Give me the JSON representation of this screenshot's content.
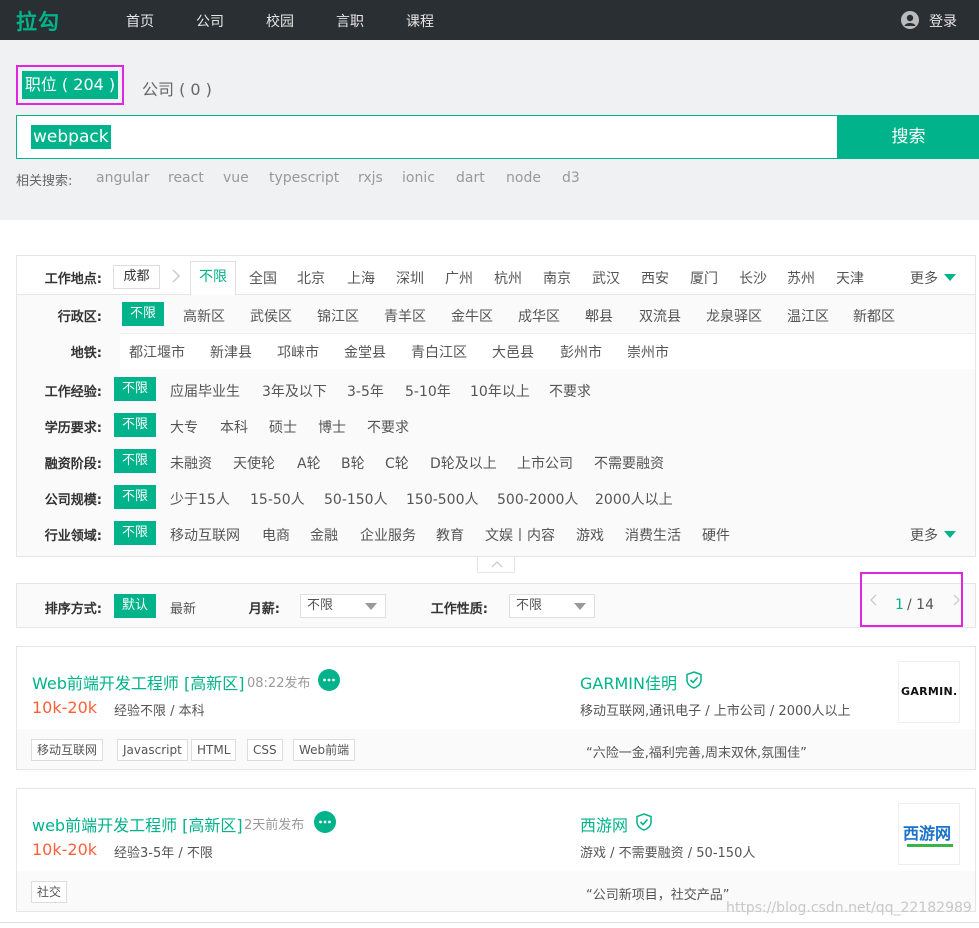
{
  "topbar": {
    "logo": "拉勾",
    "nav": [
      "首页",
      "公司",
      "校园",
      "言职",
      "课程"
    ],
    "login": "登录"
  },
  "search": {
    "tab_jobs": "职位 ( 204 )",
    "tab_companies": "公司 ( 0 )",
    "query": "webpack",
    "button": "搜索",
    "related_label": "相关搜索:",
    "related": [
      "angular",
      "react",
      "vue",
      "typescript",
      "rxjs",
      "ionic",
      "dart",
      "node",
      "d3"
    ]
  },
  "filters": {
    "location_label": "工作地点:",
    "current_city": "成都",
    "cities": [
      "不限",
      "全国",
      "北京",
      "上海",
      "深圳",
      "广州",
      "杭州",
      "南京",
      "武汉",
      "西安",
      "厦门",
      "长沙",
      "苏州",
      "天津"
    ],
    "more": "更多",
    "district_label": "行政区:",
    "districts": [
      "不限",
      "高新区",
      "武侯区",
      "锦江区",
      "青羊区",
      "金牛区",
      "成华区",
      "郫县",
      "双流县",
      "龙泉驿区",
      "温江区",
      "新都区"
    ],
    "metro_label": "地铁:",
    "metro": [
      "都江堰市",
      "新津县",
      "邛崃市",
      "金堂县",
      "青白江区",
      "大邑县",
      "彭州市",
      "崇州市"
    ],
    "experience_label": "工作经验:",
    "experience": [
      "不限",
      "应届毕业生",
      "3年及以下",
      "3-5年",
      "5-10年",
      "10年以上",
      "不要求"
    ],
    "education_label": "学历要求:",
    "education": [
      "不限",
      "大专",
      "本科",
      "硕士",
      "博士",
      "不要求"
    ],
    "financing_label": "融资阶段:",
    "financing": [
      "不限",
      "未融资",
      "天使轮",
      "A轮",
      "B轮",
      "C轮",
      "D轮及以上",
      "上市公司",
      "不需要融资"
    ],
    "size_label": "公司规模:",
    "size": [
      "不限",
      "少于15人",
      "15-50人",
      "50-150人",
      "150-500人",
      "500-2000人",
      "2000人以上"
    ],
    "industry_label": "行业领域:",
    "industry": [
      "不限",
      "移动互联网",
      "电商",
      "金融",
      "企业服务",
      "教育",
      "文娱丨内容",
      "游戏",
      "消费生活",
      "硬件"
    ],
    "industry_more": "更多"
  },
  "sort": {
    "label": "排序方式:",
    "default": "默认",
    "newest": "最新",
    "salary_label": "月薪:",
    "salary_value": "不限",
    "nature_label": "工作性质:",
    "nature_value": "不限",
    "page_current": "1",
    "page_total": "/ 14"
  },
  "jobs": [
    {
      "title": "Web前端开发工程师 [高新区]",
      "time": "08:22发布",
      "salary": "10k-20k",
      "requirements": "经验不限 / 本科",
      "company": "GARMIN佳明",
      "company_meta": "移动互联网,通讯电子 / 上市公司 / 2000人以上",
      "tags": [
        "移动互联网",
        "Javascript",
        "HTML",
        "CSS",
        "Web前端"
      ],
      "slogan": "“六险一金,福利完善,周末双休,氛围佳”",
      "logo_text": "GARMIN."
    },
    {
      "title": "web前端开发工程师 [高新区]",
      "time": "2天前发布",
      "salary": "10k-20k",
      "requirements": "经验3-5年 / 不限",
      "company": "西游网",
      "company_meta": "游戏 / 不需要融资 / 50-150人",
      "tags": [
        "社交"
      ],
      "slogan": "“公司新项目，社交产品”",
      "logo_text": "西游网"
    }
  ],
  "watermark": "https://blog.csdn.net/qq_22182989",
  "colors": {
    "brand": "#00b38a",
    "salary": "#fd5f39",
    "highlight_box": "#e126e1",
    "topbar": "#2a2f33"
  }
}
